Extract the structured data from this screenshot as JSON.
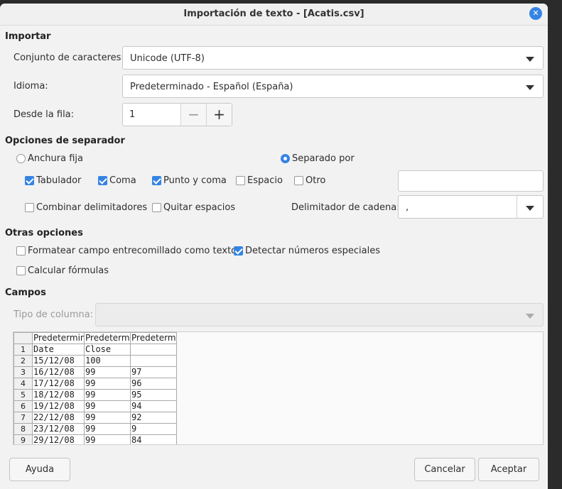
{
  "dialog": {
    "title": "Importación de texto - [Acatis.csv]"
  },
  "import": {
    "section": "Importar",
    "charset_label": "Conjunto de caracteres:",
    "charset_value": "Unicode (UTF-8)",
    "language_label": "Idioma:",
    "language_value": "Predeterminado - Español (España)",
    "from_row_label": "Desde la fila:",
    "from_row_value": "1"
  },
  "separator": {
    "section": "Opciones de separador",
    "fixed_width": "Anchura fija",
    "separated_by": "Separado por",
    "tab": "Tabulador",
    "comma": "Coma",
    "semicolon": "Punto y coma",
    "space": "Espacio",
    "other": "Otro",
    "merge": "Combinar delimitadores",
    "trim": "Quitar espacios",
    "string_delimiter_label": "Delimitador de cadena:",
    "string_delimiter_value": ","
  },
  "other_options": {
    "section": "Otras opciones",
    "format_quoted": "Formatear campo entrecomillado como texto",
    "detect_special": "Detectar números especiales",
    "evaluate_formulas": "Calcular fórmulas"
  },
  "fields": {
    "section": "Campos",
    "column_type_label": "Tipo de columna:",
    "headers": [
      "Predetermin",
      "Predeterm",
      "Predeterm"
    ],
    "rows": [
      {
        "n": "1",
        "c": [
          "Date",
          "Close",
          ""
        ]
      },
      {
        "n": "2",
        "c": [
          "15/12/08",
          "100",
          ""
        ]
      },
      {
        "n": "3",
        "c": [
          "16/12/08",
          "99",
          "97"
        ]
      },
      {
        "n": "4",
        "c": [
          "17/12/08",
          "99",
          "96"
        ]
      },
      {
        "n": "5",
        "c": [
          "18/12/08",
          "99",
          "95"
        ]
      },
      {
        "n": "6",
        "c": [
          "19/12/08",
          "99",
          "94"
        ]
      },
      {
        "n": "7",
        "c": [
          "22/12/08",
          "99",
          "92"
        ]
      },
      {
        "n": "8",
        "c": [
          "23/12/08",
          "99",
          "9"
        ]
      },
      {
        "n": "9",
        "c": [
          "29/12/08",
          "99",
          "84"
        ]
      }
    ]
  },
  "buttons": {
    "help": "Ayuda",
    "cancel": "Cancelar",
    "accept": "Aceptar"
  },
  "colors": {
    "accent": "#3584e4"
  }
}
